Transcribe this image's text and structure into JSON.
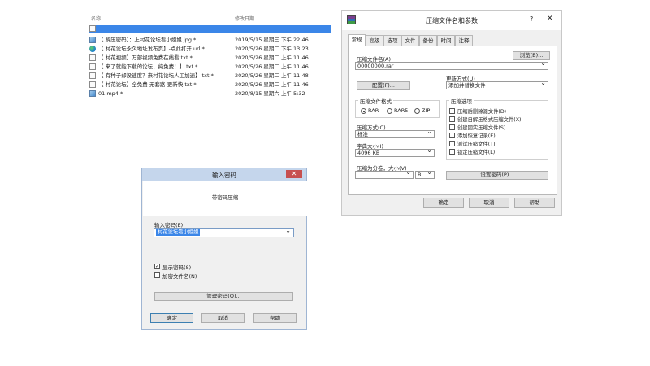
{
  "file_list": {
    "col_name": "名称",
    "col_date": "修改日期",
    "rows": [
      {
        "icon": "image-file-icon",
        "name": "【 解压密码】：上村花论坛看小姐姐.jpg *",
        "date": "2019/5/15 星期三 下午 22:46"
      },
      {
        "icon": "web-shortcut-icon",
        "name": "【 村花论坛永久地址发布页】-点此打开.url *",
        "date": "2020/5/26 星期二 下午 13:23"
      },
      {
        "icon": "text-file-icon",
        "name": "【 村花视频】万部视频免费在线看.txt *",
        "date": "2020/5/26 星期二 上午 11:46"
      },
      {
        "icon": "text-file-icon",
        "name": "【 来了就能下载的论坛，纯免费！】.txt *",
        "date": "2020/5/26 星期二 上午 11:46"
      },
      {
        "icon": "text-file-icon",
        "name": "【 有种子却没速度？来村花论坛人工加速】.txt *",
        "date": "2020/5/26 星期二 上午 11:48"
      },
      {
        "icon": "text-file-icon",
        "name": "【 村花论坛】全免费-无套路-更新快.txt *",
        "date": "2020/5/26 星期二 上午 11:46"
      },
      {
        "icon": "video-file-icon",
        "name": "01.mp4 *",
        "date": "2020/8/15 星期六 上午 5:32"
      }
    ]
  },
  "rar_dialog": {
    "title": "压缩文件名和参数",
    "help": "?",
    "close": "✕",
    "tabs": [
      "常规",
      "高级",
      "选项",
      "文件",
      "备份",
      "时间",
      "注释"
    ],
    "active_tab": "常规",
    "archive_name_label": "压缩文件名(A)",
    "archive_name_value": "00000000.rar",
    "browse_button": "浏览(B)...",
    "update_mode_label": "更新方式(U)",
    "update_mode_value": "添加并替换文件",
    "profiles_button": "配置(F)...",
    "format_group": "压缩文件格式",
    "formats": [
      {
        "label": "RAR",
        "selected": true
      },
      {
        "label": "RAR5",
        "selected": false
      },
      {
        "label": "ZIP",
        "selected": false
      }
    ],
    "method_label": "压缩方式(C)",
    "method_value": "标准",
    "dict_label": "字典大小(I)",
    "dict_value": "4096 KB",
    "split_label": "压缩为分卷，大小(V)",
    "split_value": "",
    "split_unit": "B",
    "options_group": "压缩选项",
    "options": [
      {
        "label": "压缩后删除源文件(D)",
        "checked": false
      },
      {
        "label": "创建自解压格式压缩文件(X)",
        "checked": false
      },
      {
        "label": "创建固实压缩文件(S)",
        "checked": false
      },
      {
        "label": "添加恢复记录(E)",
        "checked": false
      },
      {
        "label": "测试压缩文件(T)",
        "checked": false
      },
      {
        "label": "锁定压缩文件(L)",
        "checked": false
      }
    ],
    "set_password_button": "设置密码(P)...",
    "ok_button": "确定",
    "cancel_button": "取消",
    "help_button": "帮助"
  },
  "password_dialog": {
    "title": "输入密码",
    "close": "✕",
    "header": "带密码压缩",
    "input_label": "输入密码(E)",
    "input_value": "村花论坛看小姐姐",
    "show_password_label": "显示密码(S)",
    "show_password_checked": true,
    "encrypt_names_label": "加密文件名(N)",
    "encrypt_names_checked": false,
    "manage_button": "管理密码(O)...",
    "ok_button": "确定",
    "cancel_button": "取消",
    "help_button": "帮助"
  }
}
